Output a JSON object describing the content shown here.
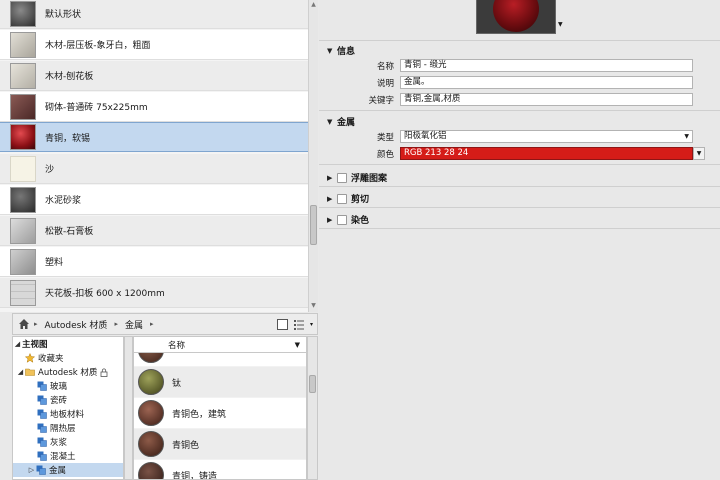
{
  "materials": [
    {
      "label": "默认形状",
      "swatch": "#5a5a5a"
    },
    {
      "label": "木材-层压板-象牙白，粗面",
      "swatch": "#c9c6bd"
    },
    {
      "label": "木材-刨花板",
      "swatch": "#d3d0c7"
    },
    {
      "label": "砌体-普通砖 75x225mm",
      "swatch": "#6e3f3c"
    },
    {
      "label": "青铜，软锡",
      "swatch": "#a4161d",
      "selected": true
    },
    {
      "label": "沙",
      "swatch": "#f4f1e3"
    },
    {
      "label": "水泥砂浆",
      "swatch": "#4a4a4a"
    },
    {
      "label": "松散-石膏板",
      "swatch": "#bcbcbc"
    },
    {
      "label": "塑料",
      "swatch": "#a8a8a8"
    },
    {
      "label": "天花板-扣板 600 x 1200mm",
      "swatch": "#d2d2d2"
    }
  ],
  "breadcrumb": {
    "items": [
      "Autodesk 材质",
      "金属"
    ]
  },
  "tree": {
    "root": "主视图",
    "items": [
      {
        "label": "收藏夹",
        "icon": "star-icon"
      },
      {
        "label": "Autodesk 材质",
        "icon": "folder-icon"
      },
      {
        "label": "玻璃",
        "icon": "material-category-icon"
      },
      {
        "label": "瓷砖",
        "icon": "material-category-icon"
      },
      {
        "label": "地板材料",
        "icon": "material-category-icon"
      },
      {
        "label": "隔热层",
        "icon": "material-category-icon"
      },
      {
        "label": "灰浆",
        "icon": "material-category-icon"
      },
      {
        "label": "混凝土",
        "icon": "material-category-icon"
      },
      {
        "label": "金属",
        "icon": "material-category-icon",
        "selected": true
      }
    ]
  },
  "sublist": {
    "column": "名称",
    "items": [
      {
        "label": "钛",
        "swatch": "#6b6e3a"
      },
      {
        "label": "青铜色，建筑",
        "swatch": "#6d3d2f"
      },
      {
        "label": "青铜色",
        "swatch": "#5e3427"
      },
      {
        "label": "青铜，铸造",
        "swatch": "#4e2f27"
      }
    ]
  },
  "editor": {
    "info": {
      "title": "信息",
      "name_label": "名称",
      "name_value": "青铜 - 缎光",
      "desc_label": "说明",
      "desc_value": "金属。",
      "keywords_label": "关键字",
      "keywords_value": "青铜,金属,材质"
    },
    "metal": {
      "title": "金属",
      "type_label": "类型",
      "type_value": "阳极氧化铝",
      "color_label": "颜色",
      "color_value": "RGB 213 28 24",
      "color_hex": "#d51c18"
    },
    "sections": [
      "浮雕图案",
      "剪切",
      "染色"
    ]
  },
  "colors": {
    "selection": "#c3d8ef",
    "selection_border": "#7fa5cf"
  }
}
